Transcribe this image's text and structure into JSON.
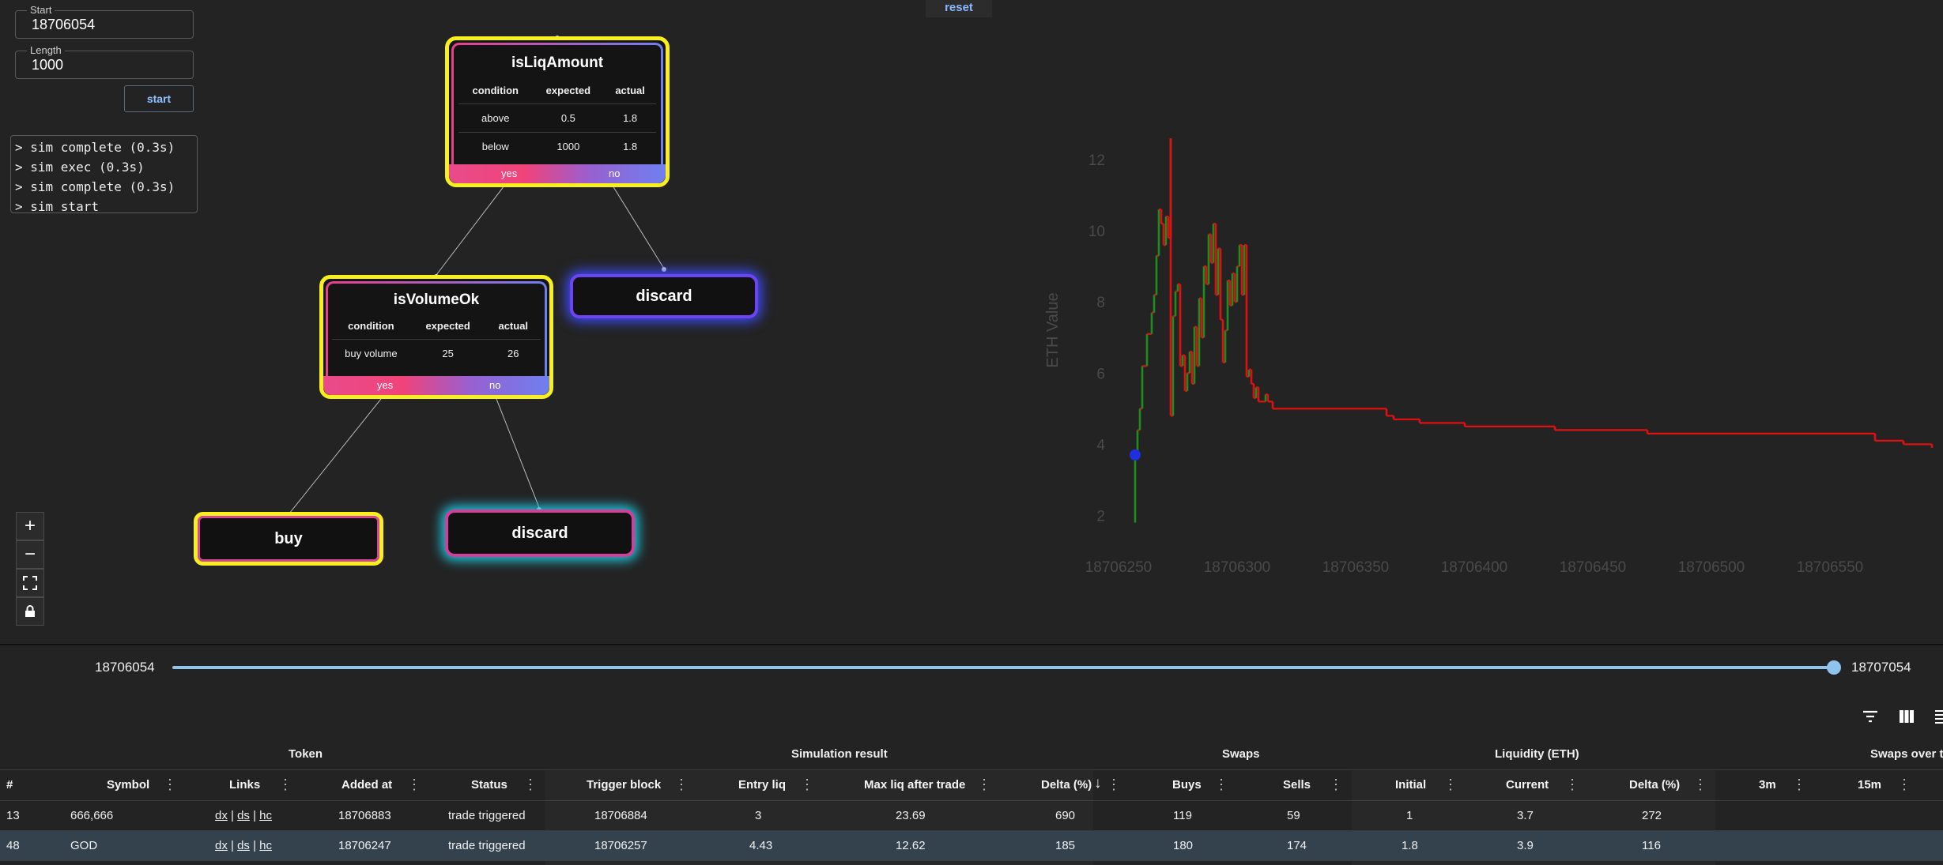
{
  "sim": {
    "start_label": "Start",
    "start_value": "18706054",
    "length_label": "Length",
    "length_value": "1000",
    "start_button": "start",
    "console": [
      "> sim complete (0.3s)",
      "> sim exec (0.3s)",
      "> sim complete (0.3s)",
      "> sim start"
    ]
  },
  "reset_label": "reset",
  "tree": {
    "root": {
      "title": "isLiqAmount",
      "headers": [
        "condition",
        "expected",
        "actual"
      ],
      "rows": [
        [
          "above",
          "0.5",
          "1.8"
        ],
        [
          "below",
          "1000",
          "1.8"
        ]
      ],
      "yes": "yes",
      "no": "no"
    },
    "child": {
      "title": "isVolumeOk",
      "headers": [
        "condition",
        "expected",
        "actual"
      ],
      "rows": [
        [
          "buy volume",
          "25",
          "26"
        ]
      ],
      "yes": "yes",
      "no": "no"
    },
    "leaf_discard_1": "discard",
    "leaf_buy": "buy",
    "leaf_discard_2": "discard"
  },
  "zoom_controls": [
    "plus-icon",
    "minus-icon",
    "fit-view-icon",
    "lock-icon"
  ],
  "chart_data": {
    "type": "line",
    "title": "",
    "xlabel": "",
    "ylabel": "ETH Value",
    "xlim": [
      18706230,
      18706595
    ],
    "ylim": [
      1.5,
      13
    ],
    "x_ticks": [
      18706250,
      18706300,
      18706350,
      18706400,
      18706450,
      18706500,
      18706550
    ],
    "y_ticks": [
      2,
      4,
      6,
      8,
      10,
      12
    ],
    "grid": false,
    "colors": {
      "up": "#1e8c1e",
      "down": "#e01010",
      "marker": "#1f2ee0"
    },
    "marker": {
      "x": 18706257,
      "y": 3.7
    },
    "series": [
      {
        "values": [
          [
            18706257,
            1.8
          ],
          [
            18706257,
            3.7
          ],
          [
            18706258,
            4.4
          ],
          [
            18706259,
            5.0
          ],
          [
            18706260,
            6.2
          ],
          [
            18706262,
            7.1
          ],
          [
            18706264,
            7.7
          ],
          [
            18706265,
            8.2
          ],
          [
            18706266,
            9.3
          ],
          [
            18706267,
            10.6
          ],
          [
            18706268,
            10.2
          ],
          [
            18706269,
            9.6
          ],
          [
            18706270,
            10.4
          ],
          [
            18706271,
            9.8
          ],
          [
            18706272,
            12.6
          ],
          [
            18706272,
            4.8
          ],
          [
            18706273,
            7.6
          ],
          [
            18706274,
            8.3
          ],
          [
            18706275,
            8.5
          ],
          [
            18706276,
            6.2
          ],
          [
            18706277,
            6.5
          ],
          [
            18706278,
            5.5
          ],
          [
            18706279,
            6.0
          ],
          [
            18706280,
            6.6
          ],
          [
            18706281,
            5.7
          ],
          [
            18706282,
            7.3
          ],
          [
            18706283,
            6.2
          ],
          [
            18706284,
            8.1
          ],
          [
            18706285,
            7.0
          ],
          [
            18706286,
            9.0
          ],
          [
            18706287,
            8.5
          ],
          [
            18706288,
            9.9
          ],
          [
            18706289,
            9.1
          ],
          [
            18706290,
            10.2
          ],
          [
            18706291,
            8.2
          ],
          [
            18706292,
            9.5
          ],
          [
            18706293,
            7.5
          ],
          [
            18706294,
            6.3
          ],
          [
            18706295,
            7.2
          ],
          [
            18706296,
            8.6
          ],
          [
            18706297,
            7.9
          ],
          [
            18706298,
            8.8
          ],
          [
            18706299,
            8.0
          ],
          [
            18706300,
            9.0
          ],
          [
            18706301,
            9.6
          ],
          [
            18706302,
            8.2
          ],
          [
            18706303,
            9.6
          ],
          [
            18706304,
            5.9
          ],
          [
            18706305,
            6.1
          ],
          [
            18706306,
            5.7
          ],
          [
            18706307,
            5.3
          ],
          [
            18706308,
            5.6
          ],
          [
            18706309,
            5.2
          ],
          [
            18706312,
            5.4
          ],
          [
            18706313,
            5.2
          ],
          [
            18706315,
            5.0
          ],
          [
            18706362,
            5.0
          ],
          [
            18706363,
            4.8
          ],
          [
            18706366,
            4.7
          ],
          [
            18706377,
            4.6
          ],
          [
            18706396,
            4.5
          ],
          [
            18706434,
            4.4
          ],
          [
            18706473,
            4.3
          ],
          [
            18706569,
            4.1
          ],
          [
            18706581,
            4.0
          ],
          [
            18706593,
            3.9
          ]
        ]
      }
    ]
  },
  "slider": {
    "min_label": "18706054",
    "max_label": "18707054",
    "fraction": 1.0
  },
  "toolbar": [
    "filter-icon",
    "columns-icon",
    "density-icon"
  ],
  "table": {
    "groups": [
      "Token",
      "Simulation result",
      "Swaps",
      "Liquidity (ETH)",
      "Swaps over ti"
    ],
    "columns": [
      "#",
      "Symbol",
      "Links",
      "Added at",
      "Status",
      "Trigger block",
      "Entry liq",
      "Max liq after trade",
      "Delta (%)",
      "Buys",
      "Sells",
      "Initial",
      "Current",
      "Delta (%)",
      "3m",
      "15m"
    ],
    "rows": [
      {
        "num": "13",
        "symbol": "666,666",
        "links": [
          "dx",
          "ds",
          "hc"
        ],
        "added": "18706883",
        "status": "trade triggered",
        "trigger": "18706884",
        "entry": "3",
        "maxliq": "23.69",
        "delta": "690",
        "buys": "119",
        "sells": "59",
        "initial": "1",
        "current": "3.7",
        "liqdelta": "272"
      },
      {
        "num": "48",
        "symbol": "GOD",
        "links": [
          "dx",
          "ds",
          "hc"
        ],
        "added": "18706247",
        "status": "trade triggered",
        "trigger": "18706257",
        "entry": "4.43",
        "maxliq": "12.62",
        "delta": "185",
        "buys": "180",
        "sells": "174",
        "initial": "1.8",
        "current": "3.9",
        "liqdelta": "116"
      }
    ]
  }
}
